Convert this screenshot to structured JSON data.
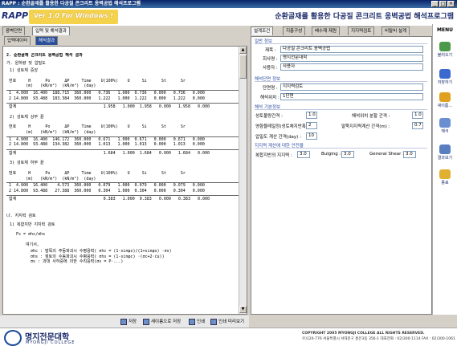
{
  "window": {
    "title": "RAPP : 순환골재를 활용한 다공질 콘크리트 옹벽공법 해석프로그램",
    "logo": "RAPP",
    "version": "Ver 1.0 For Windows !",
    "header_title": "순환골재를 활용한 다공질 콘크리트 옹벽공법 해석프로그램",
    "min": "_",
    "max": "□",
    "close": "×"
  },
  "left_tabs": [
    "옹벽단면",
    "입력 및 해석결과"
  ],
  "sub_tabs": [
    "입력데이터",
    "해석결과"
  ],
  "report": {
    "heading": "2. 순환골재 콘크리트 옹벽공법 해석 결과",
    "sec_a": "가. 원하량 및 압밀도",
    "s1": "1) 성토체 중앙",
    "s2": "2) 성토체 상부 끝",
    "s3": "3) 성토체 하부 끝",
    "header1": " 번호     H      Po      ΔP     Time    U(100%)    U     Si      St      Sr",
    "header2": "        (m)   (kN/m²)  (kN/m²)  (day)",
    "t1": [
      " 1  4.000  16.400  188.715  360.000   0.736   1.000  0.736   0.000   0.736   0.000",
      " 2 14.800  93.488  183.384  360.000   1.222   1.000  1.222   0.000   1.222   0.000"
    ],
    "t1sum": " 합계                                    1.958   1.000  1.958   0.000   1.958   0.000",
    "t2": [
      " 1  4.000  16.400  146.172  360.000   0.671   1.000  0.671   0.000   0.671   0.000",
      " 2 14.800  93.488  134.382  360.000   1.013   1.000  1.013   0.000   1.013   0.000"
    ],
    "t2sum": " 합계                                    1.684   1.000  1.684   0.000   1.684   0.000",
    "t3": [
      " 1  4.000  16.400    4.573  360.000   0.079   1.000  0.079   0.000   0.079   0.000",
      " 2 14.800  93.488   27.388  360.000   0.304   1.000  0.304   0.000   0.304   0.000"
    ],
    "t3sum": " 합계                                    0.383   1.000  0.383   0.000   0.383   0.000",
    "sec_b": "나. 지지력 검토",
    "b1": "1) 복합지반 지지력 검토",
    "formula": "Fs = σhc/σhs",
    "where": "여기서,",
    "w1": "σhc : 말뚝의 주동파괴시 수평응력( σhc = (1-sinφs)/(1+sinφs) ·σs)",
    "w2": "σhs : 점토의 수동파괴시 수평응력( σhs = (1-sinφc) ·(σc+2·cu))",
    "w3": "σs : 과대 사하중에 의한 수직응력(σs = P·...)"
  },
  "bottom_buttons": [
    "저장",
    "새이름으로 저장",
    "인쇄",
    "인쇄 미리보기"
  ],
  "right_tabs": [
    "설계조건",
    "지층구성",
    "배수재 제원",
    "지지력검토",
    "비탈비 설계"
  ],
  "form": {
    "general": "일반 정보",
    "title_lbl": "제목 :",
    "title_val": "다공질 콘크리트 옹벽공법",
    "company_lbl": "회사명 :",
    "company_val": "명지전문대학",
    "user_lbl": "사용자 :",
    "user_val": "사용자",
    "section": "해석단면 정보",
    "sec_name_lbl": "단면명 :",
    "sec_name_val": "지지력검토",
    "sec_loc_lbl": "해석위치 :",
    "sec_loc_val": "1단면",
    "common": "해석 기본정보",
    "c1_lbl": "성토불량간격 :",
    "c1_val": "1.0",
    "c2_lbl": "해석위치 분할 간격 :",
    "c2_val": "1.0",
    "c3_lbl": "영향블레일정(성토체지반폭×2) :",
    "c3_val": "2",
    "c4_lbl": "말뚝지지력계산 간격(m) :",
    "c4_val": "0.7",
    "c5_lbl": "압밀도 계산 간격(day) :",
    "c5_val": "10",
    "bearing": "지지력 계산에 대한 안전율",
    "b1_lbl": "복합지반의 지지력 :",
    "b1_val": "3.0",
    "b2_lbl": "Bulging :",
    "b2_val": "3.0",
    "b3_lbl": "General Shear :",
    "b3_val": "3.0"
  },
  "menu": {
    "label": "MENU",
    "items": [
      "불러오기",
      "저장하기",
      "새이름…",
      "해석",
      "결과보기",
      "종료"
    ]
  },
  "footer": {
    "univ": "명지전문대학",
    "univ_en": "MYONGJI COLLEGE",
    "copy1": "COPYRIGHT 2005 MYONGJI COLLEGE ALL RIGHTS RESERVED.",
    "copy2": "우)120-776 서울특별시 서대문구 홍은3동 356-1 대표전화 : 02)300-1114 FAX : 02)300-1061"
  }
}
